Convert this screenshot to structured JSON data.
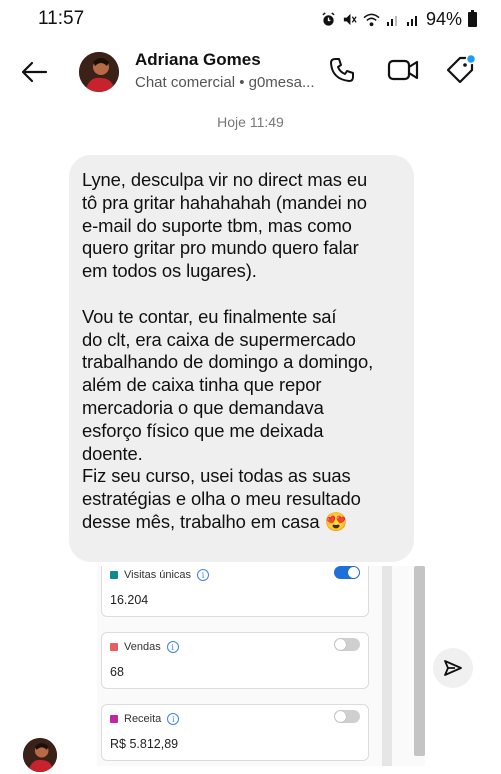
{
  "status_bar": {
    "time": "11:57",
    "battery": "94%",
    "icons": [
      "alarm-icon",
      "mute-icon",
      "wifi-icon",
      "signal-icon",
      "signal-icon",
      "battery-icon"
    ]
  },
  "header": {
    "name": "Adriana Gomes",
    "subtitle": "Chat comercial • g0mesa...",
    "icons": [
      "back-arrow-icon",
      "phone-icon",
      "video-icon",
      "tag-icon"
    ]
  },
  "timestamp": "Hoje 11:49",
  "message": {
    "text": "Lyne, desculpa vir no direct mas eu\ntô pra gritar hahahahah (mandei no\ne-mail do suporte tbm, mas como\nquero gritar pro mundo quero falar\nem todos os lugares).\n\nVou te contar, eu finalmente saí\ndo clt, era caixa de supermercado\ntrabalhando de domingo a domingo,\nalém de caixa tinha que repor\nmercadoria o que demandava\nesforço físico que me deixada\ndoente.\nFiz seu curso, usei todas as suas\nestratégias e olha o meu resultado\ndesse mês, trabalho em casa 😍",
    "background": "#efefef"
  },
  "attachment": {
    "metrics": [
      {
        "label": "Visitas únicas",
        "value": "16.204",
        "color": "#0f8b8d",
        "toggle_on": true
      },
      {
        "label": "Vendas",
        "value": "68",
        "color": "#e85d5d",
        "toggle_on": false
      },
      {
        "label": "Receita",
        "value": "R$ 5.812,89",
        "color": "#c026a3",
        "toggle_on": false
      }
    ],
    "toggle_on_color": "#1e6fd9",
    "toggle_off_color": "#cfcfcf"
  },
  "share_icon": "send-icon"
}
